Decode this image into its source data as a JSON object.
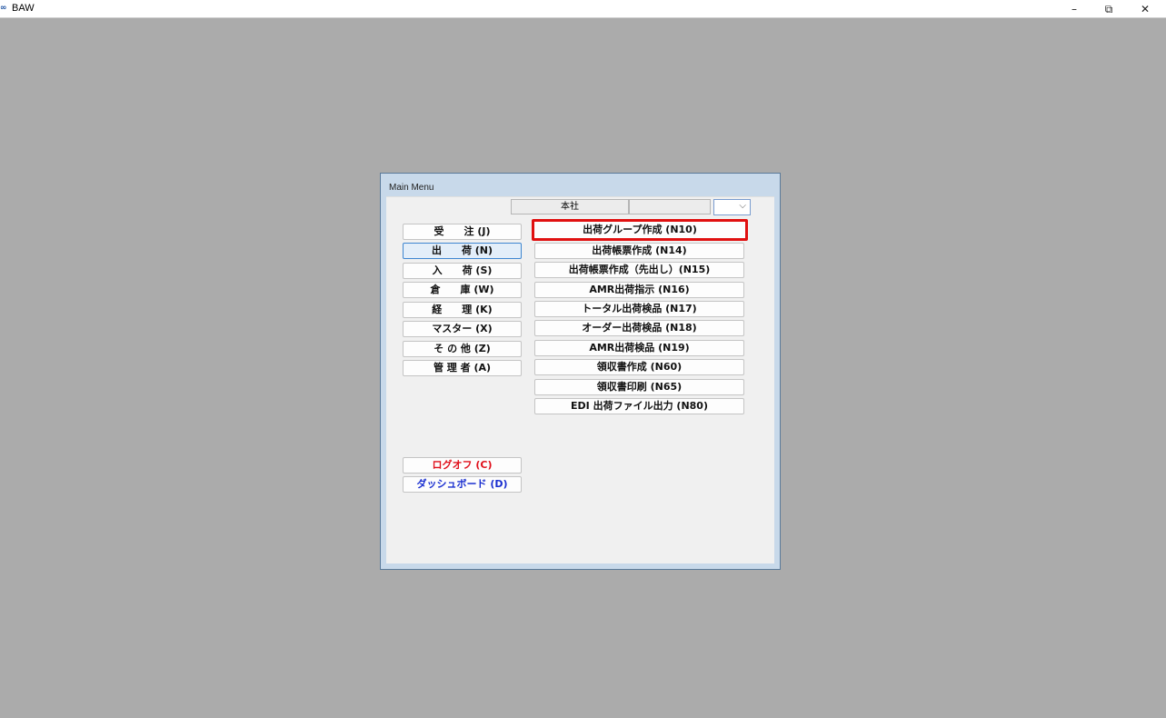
{
  "window": {
    "app_title": "BAW",
    "controls": {
      "minimize": "–",
      "maximize": "⧉",
      "close": "✕"
    }
  },
  "main_menu": {
    "title": "Main Menu",
    "branch": "本社",
    "branch_extra": "",
    "combo_arrow": "⌵"
  },
  "categories": [
    {
      "label": "受　　注 (J)",
      "active": false
    },
    {
      "label": "出　　荷 (N)",
      "active": true
    },
    {
      "label": "入　　荷 (S)",
      "active": false
    },
    {
      "label": "倉　　庫 (W)",
      "active": false
    },
    {
      "label": "経　　理 (K)",
      "active": false
    },
    {
      "label": "マスター (X)",
      "active": false
    },
    {
      "label": "そ の 他 (Z)",
      "active": false
    },
    {
      "label": "管 理 者 (A)",
      "active": false
    }
  ],
  "functions": [
    {
      "label": "出荷グループ作成 (N10)",
      "highlighted": true
    },
    {
      "label": "出荷帳票作成 (N14)",
      "highlighted": false
    },
    {
      "label": "出荷帳票作成（先出し）(N15)",
      "highlighted": false
    },
    {
      "label": "AMR出荷指示 (N16)",
      "highlighted": false
    },
    {
      "label": "トータル出荷検品 (N17)",
      "highlighted": false
    },
    {
      "label": "オーダー出荷検品 (N18)",
      "highlighted": false
    },
    {
      "label": "AMR出荷検品 (N19)",
      "highlighted": false
    },
    {
      "label": "領収書作成 (N60)",
      "highlighted": false
    },
    {
      "label": "領収書印刷 (N65)",
      "highlighted": false
    },
    {
      "label": "EDI 出荷ファイル出力 (N80)",
      "highlighted": false
    }
  ],
  "logoff_label": "ログオフ (C)",
  "dashboard_label": "ダッシュボード (D)",
  "colors": {
    "highlight_border": "#e01010",
    "logoff_text": "#e0101b",
    "dashboard_text": "#1a2fd0",
    "active_border": "#3f86d0"
  }
}
